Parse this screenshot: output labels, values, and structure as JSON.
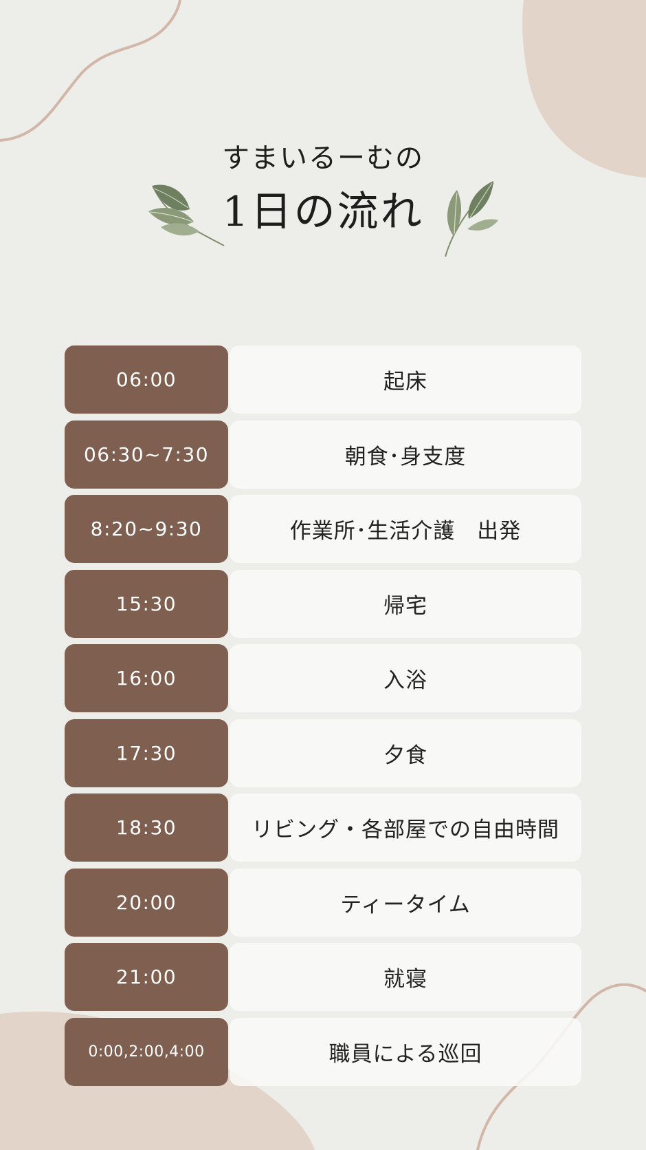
{
  "title": {
    "subtitle": "すまいるーむの",
    "main": "1日の流れ"
  },
  "icons": {
    "left_leaf": "leaf-branch-icon",
    "right_leaf": "leaf-branch-icon"
  },
  "colors": {
    "background": "#ededea",
    "time_cell": "#7e5f50",
    "event_cell": "#f9f9f7",
    "accent_shape": "#e2d4c9",
    "curve_line": "#d2b7a9"
  },
  "schedule": [
    {
      "time": "06:00",
      "event": "起床"
    },
    {
      "time": "06:30~7:30",
      "event": "朝食･身支度"
    },
    {
      "time": "8:20~9:30",
      "event": "作業所･生活介護　出発"
    },
    {
      "time": "15:30",
      "event": "帰宅"
    },
    {
      "time": "16:00",
      "event": "入浴"
    },
    {
      "time": "17:30",
      "event": "夕食"
    },
    {
      "time": "18:30",
      "event": "リビング・各部屋での自由時間"
    },
    {
      "time": "20:00",
      "event": "ティータイム"
    },
    {
      "time": "21:00",
      "event": "就寝"
    },
    {
      "time": "0:00,2:00,4:00",
      "event": "職員による巡回"
    }
  ]
}
